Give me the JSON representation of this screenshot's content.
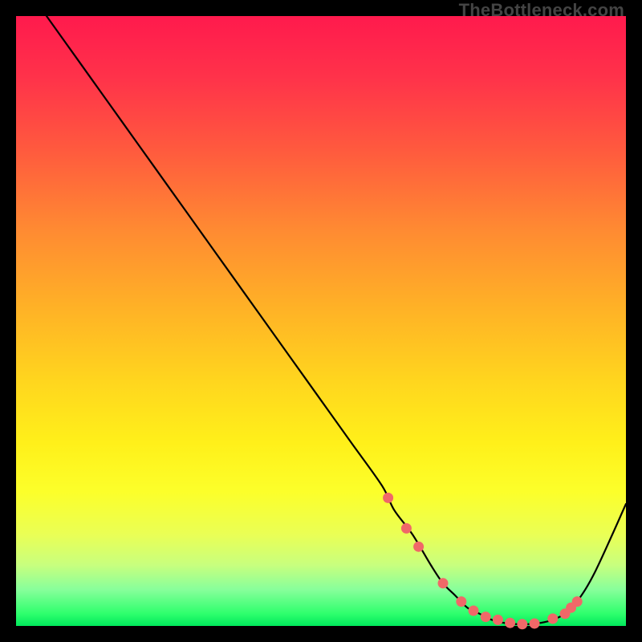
{
  "watermark": "TheBottleneck.com",
  "colors": {
    "marker": "#f06868",
    "curve": "#000000"
  },
  "chart_data": {
    "type": "line",
    "title": "",
    "xlabel": "",
    "ylabel": "",
    "xlim": [
      0,
      100
    ],
    "ylim": [
      0,
      100
    ],
    "grid": false,
    "legend": false,
    "series": [
      {
        "name": "bottleneck-curve",
        "x": [
          5,
          10,
          15,
          20,
          25,
          30,
          35,
          40,
          45,
          50,
          55,
          60,
          62,
          65,
          68,
          70,
          72,
          74,
          76,
          78,
          80,
          82,
          84,
          86,
          88,
          90,
          92,
          95,
          100
        ],
        "y": [
          100,
          93,
          86,
          79,
          72,
          65,
          58,
          51,
          44,
          37,
          30,
          23,
          19,
          15,
          10,
          7,
          5,
          3,
          2,
          1,
          0.5,
          0.3,
          0.3,
          0.5,
          1,
          2,
          4,
          9,
          20
        ]
      }
    ],
    "markers": {
      "name": "highlight-points",
      "x": [
        61,
        64,
        66,
        70,
        73,
        75,
        77,
        79,
        81,
        83,
        85,
        88,
        90,
        91,
        92
      ],
      "y": [
        21,
        16,
        13,
        7,
        4,
        2.5,
        1.5,
        1,
        0.5,
        0.3,
        0.4,
        1.2,
        2,
        3,
        4
      ]
    }
  }
}
